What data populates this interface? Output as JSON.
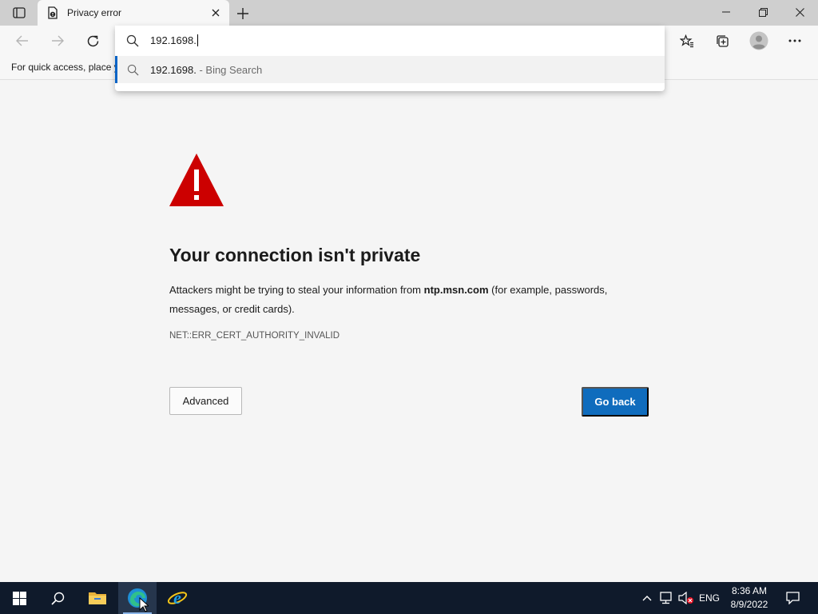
{
  "tab": {
    "title": "Privacy error"
  },
  "favorites_bar": {
    "text": "For quick access, place y"
  },
  "omnibox": {
    "input_value": "192.1698.",
    "suggestion": {
      "text": "192.1698.",
      "suffix": " - Bing Search"
    }
  },
  "page": {
    "heading": "Your connection isn't private",
    "desc_part1": "Attackers might be trying to steal your information from ",
    "desc_domain": "ntp.msn.com",
    "desc_part2": " (for example, passwords, messages, or credit cards).",
    "error_code": "NET::ERR_CERT_AUTHORITY_INVALID",
    "advanced_label": "Advanced",
    "go_back_label": "Go back"
  },
  "taskbar": {
    "language": "ENG",
    "time": "8:36 AM",
    "date": "8/9/2022"
  },
  "colors": {
    "warning_red": "#cc0000",
    "accent_blue": "#0f6cbd",
    "taskbar_bg": "#0f1a2b"
  }
}
